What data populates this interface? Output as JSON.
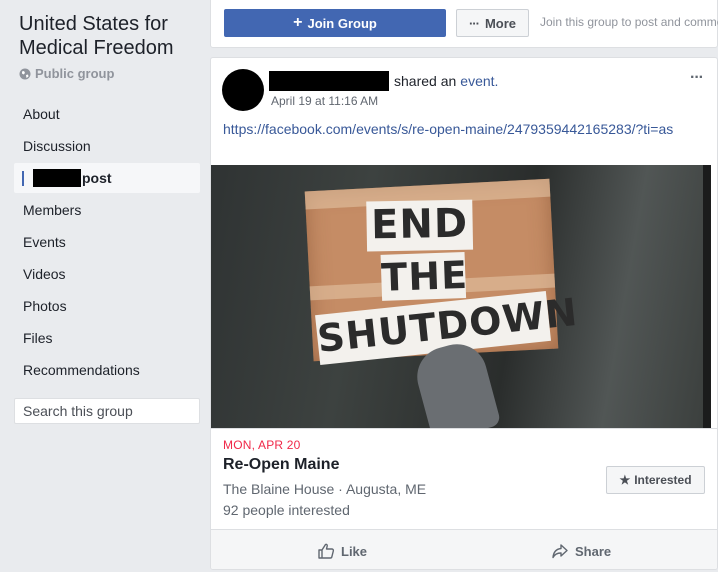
{
  "group": {
    "name": "United States for Medical Freedom",
    "privacy": "Public group"
  },
  "sidebar": {
    "items": [
      {
        "label": "About"
      },
      {
        "label": "Discussion"
      },
      {
        "label": "post"
      },
      {
        "label": "Members"
      },
      {
        "label": "Events"
      },
      {
        "label": "Videos"
      },
      {
        "label": "Photos"
      },
      {
        "label": "Files"
      },
      {
        "label": "Recommendations"
      }
    ],
    "search_placeholder": "Search this group"
  },
  "actions": {
    "join_label": "Join Group",
    "more_label": "More",
    "join_hint": "Join this group to post and comment."
  },
  "post": {
    "shared_text": "shared an",
    "event_word": "event.",
    "timestamp": "April 19 at 11:16 AM",
    "url": "https://facebook.com/events/s/re-open-maine/2479359442165283/?ti=as",
    "image_sign": [
      "END",
      "THE",
      "SHUTDOWN"
    ],
    "event": {
      "date": "MON, APR 20",
      "title": "Re-Open Maine",
      "location": "The Blaine House · Augusta, ME",
      "interested_count": "92 people interested",
      "interested_label": "Interested"
    },
    "like_label": "Like",
    "share_label": "Share"
  },
  "colors": {
    "brand": "#4267b2",
    "link": "#385898",
    "event_date": "#f02849",
    "background": "#e9ebee"
  }
}
